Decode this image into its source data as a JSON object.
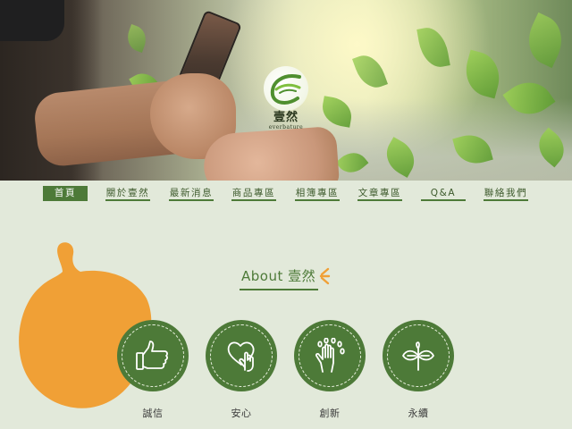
{
  "brand": {
    "name": "壹然",
    "subtitle": "everbature"
  },
  "nav": {
    "items": [
      {
        "label": "首頁",
        "active": true
      },
      {
        "label": "關於壹然",
        "active": false
      },
      {
        "label": "最新消息",
        "active": false
      },
      {
        "label": "商品專區",
        "active": false
      },
      {
        "label": "相簿專區",
        "active": false
      },
      {
        "label": "文章專區",
        "active": false
      },
      {
        "label": "Q&A",
        "active": false
      },
      {
        "label": "聯絡我們",
        "active": false
      }
    ]
  },
  "about": {
    "title": "About 壹然",
    "features": [
      {
        "label": "誠信",
        "icon": "thumbs-up-icon"
      },
      {
        "label": "安心",
        "icon": "heart-hand-icon"
      },
      {
        "label": "創新",
        "icon": "hand-sparkle-icon"
      },
      {
        "label": "永續",
        "icon": "sprout-icon"
      }
    ]
  },
  "colors": {
    "background": "#e2e9da",
    "primary_green": "#4d7a38",
    "accent_orange": "#f0a036"
  }
}
